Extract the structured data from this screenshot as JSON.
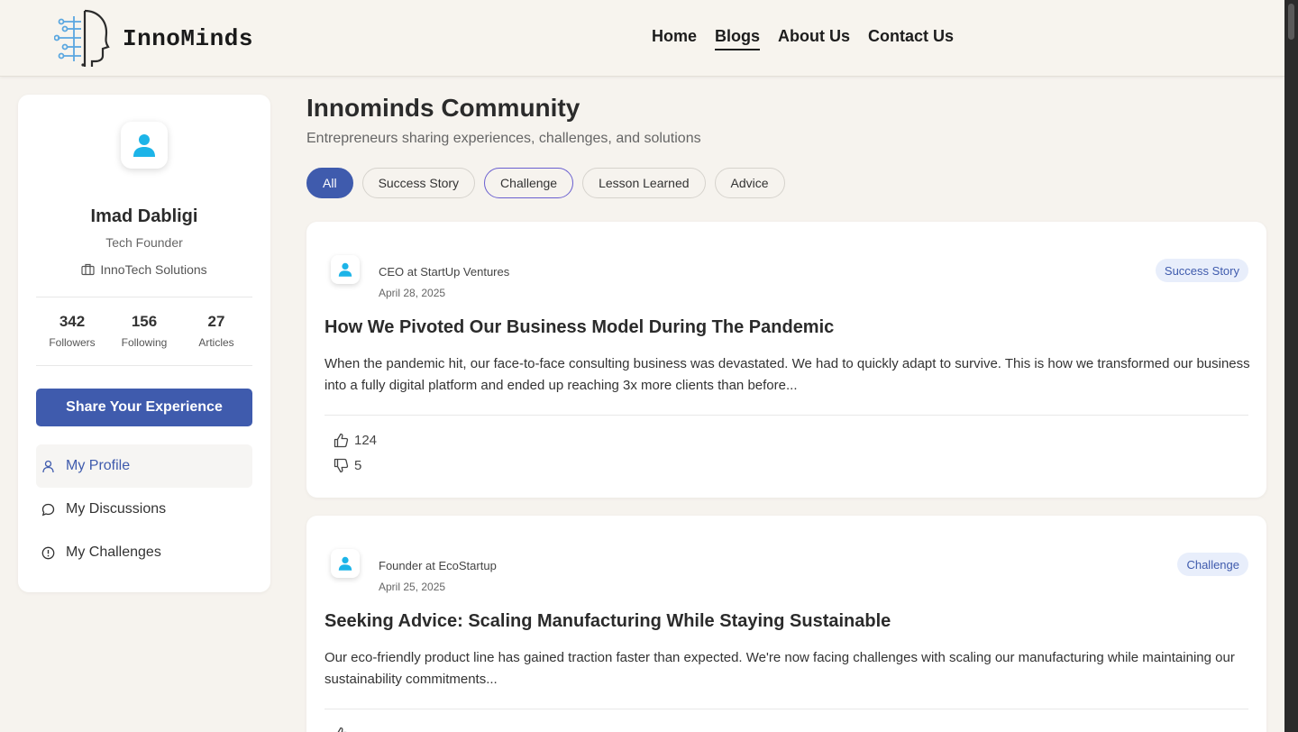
{
  "header": {
    "logo_text": "InnoMinds",
    "nav": [
      {
        "label": "Home"
      },
      {
        "label": "Blogs"
      },
      {
        "label": "About Us"
      },
      {
        "label": "Contact Us"
      }
    ],
    "active_nav": "Blogs"
  },
  "profile": {
    "name": "Imad Dabligi",
    "role": "Tech Founder",
    "company": "InnoTech Solutions",
    "stats": [
      {
        "value": "342",
        "label": "Followers"
      },
      {
        "value": "156",
        "label": "Following"
      },
      {
        "value": "27",
        "label": "Articles"
      }
    ],
    "share_button": "Share Your Experience",
    "menu": [
      {
        "label": "My Profile",
        "icon": "user-icon"
      },
      {
        "label": "My Discussions",
        "icon": "chat-bubble-icon"
      },
      {
        "label": "My Challenges",
        "icon": "alert-circle-icon"
      }
    ]
  },
  "main": {
    "title": "Innominds Community",
    "subtitle": "Entrepreneurs sharing experiences, challenges, and solutions",
    "filters": [
      "All",
      "Success Story",
      "Challenge",
      "Lesson Learned",
      "Advice"
    ],
    "selected_filter": "All",
    "posts": [
      {
        "author": "CEO at StartUp Ventures",
        "date": "April 28, 2025",
        "tag": "Success Story",
        "title": "How We Pivoted Our Business Model During The Pandemic",
        "excerpt": "When the pandemic hit, our face-to-face consulting business was devastated. We had to quickly adapt to survive. This is how we transformed our business into a fully digital platform and ended up reaching 3x more clients than before...",
        "likes": "124",
        "dislikes": "5"
      },
      {
        "author": "Founder at EcoStartup",
        "date": "April 25, 2025",
        "tag": "Challenge",
        "title": "Seeking Advice: Scaling Manufacturing While Staying Sustainable",
        "excerpt": "Our eco-friendly product line has gained traction faster than expected. We're now facing challenges with scaling our manufacturing while maintaining our sustainability commitments..."
      }
    ]
  },
  "colors": {
    "accent": "#3f5bad",
    "avatar_icon": "#1cb4e8",
    "background": "#f6f3ee"
  }
}
